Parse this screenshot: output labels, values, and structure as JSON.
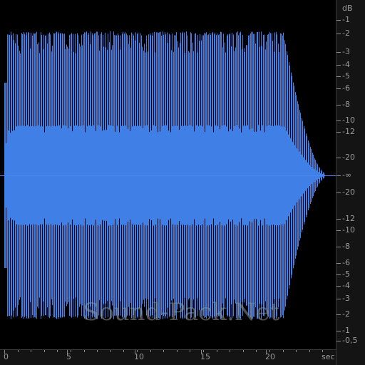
{
  "db_scale": {
    "unit_label": "dB",
    "top_labels": [
      "-1",
      "-2",
      "-3",
      "-4",
      "-5",
      "-6",
      "-8",
      "-10",
      "-12",
      "-20"
    ],
    "center_label": "-∞",
    "bottom_labels": [
      "-20",
      "-12",
      "-10",
      "-8",
      "-6",
      "-5",
      "-4",
      "-3",
      "-2",
      "-1",
      "-0,5"
    ]
  },
  "time_scale": {
    "labels": [
      "0",
      "5",
      "10",
      "15",
      "20"
    ],
    "unit_label": "sec"
  },
  "waveform": {
    "color": "#3f7fe6",
    "center_line_color": "#4a86ee",
    "sustain_until_sec": 21.3,
    "decay_until_sec": 24.5,
    "total_sec": 25
  },
  "watermark": "Sound-Pack.Net"
}
